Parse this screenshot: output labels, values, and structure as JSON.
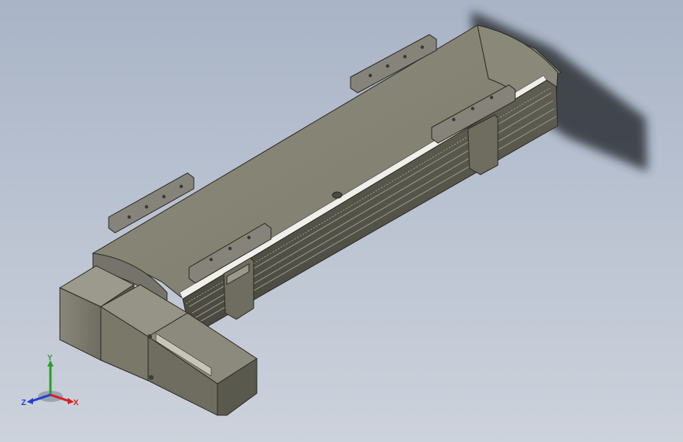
{
  "viewport": {
    "background_top": "#a9b4c6",
    "background_bottom": "#cdd2db"
  },
  "model": {
    "description_color": "#7d7b6c",
    "shadow_color": "#2e3238"
  },
  "triad": {
    "x_label": "X",
    "y_label": "Y",
    "z_label": "Z",
    "x_color": "#d81f1f",
    "y_color": "#2e9c2e",
    "z_color": "#2440d0"
  }
}
